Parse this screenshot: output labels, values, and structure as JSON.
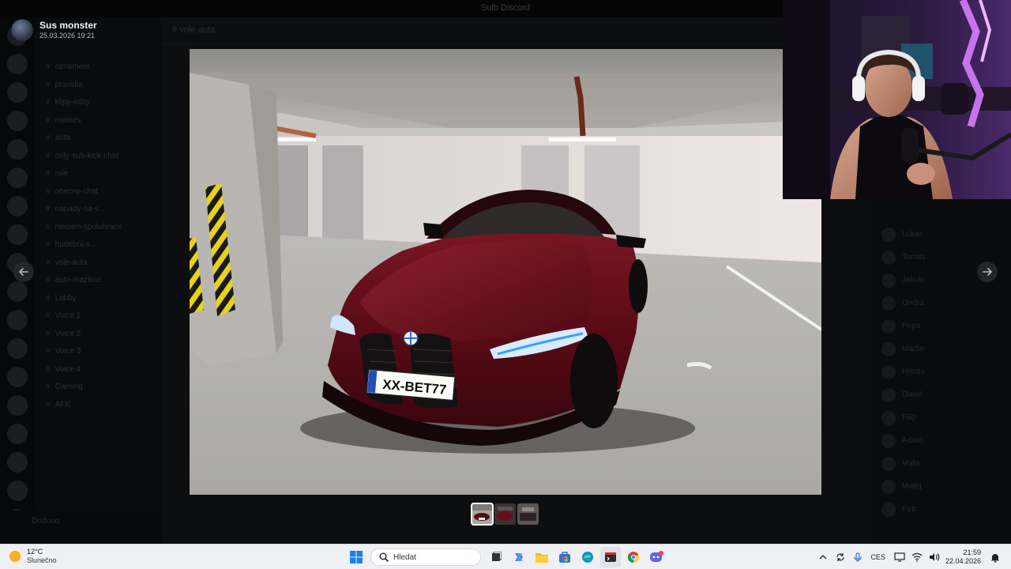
{
  "background": {
    "window_title": "Sulb Discord",
    "channel_header": "# vole-auta",
    "channels": [
      {
        "label": "oznameni"
      },
      {
        "label": "pravidla"
      },
      {
        "label": "klipy-edity"
      },
      {
        "label": "memes"
      },
      {
        "label": "auta"
      },
      {
        "label": "only-sub-kick-chat"
      },
      {
        "label": "role"
      },
      {
        "label": "obecny-chat"
      },
      {
        "label": "napady-na-v..."
      },
      {
        "label": "hledam-spoluhrace"
      },
      {
        "label": "hudebni-s..."
      },
      {
        "label": "vole-auta"
      },
      {
        "label": "auto-mazlicci"
      },
      {
        "label": "Lobby"
      },
      {
        "label": "Voice 1"
      },
      {
        "label": "Voice 2"
      },
      {
        "label": "Voice 3"
      },
      {
        "label": "Voice 4"
      },
      {
        "label": "Gaming"
      },
      {
        "label": "AFK"
      }
    ],
    "members": [
      {
        "name": "Lukas"
      },
      {
        "name": "Tomas"
      },
      {
        "name": "Jakub"
      },
      {
        "name": "Ondra"
      },
      {
        "name": "Pepa"
      },
      {
        "name": "Martin"
      },
      {
        "name": "Honza"
      },
      {
        "name": "David"
      },
      {
        "name": "Filip"
      },
      {
        "name": "Adam"
      },
      {
        "name": "Vojta"
      },
      {
        "name": "Matej"
      },
      {
        "name": "Petr"
      }
    ],
    "user_panel": "Dodouo"
  },
  "viewer": {
    "author": "Sus monster",
    "timestamp": "25.03.2026 19:21",
    "plate_text": "XX-BET77",
    "plate_country": "SK",
    "thumbnails_count": 3,
    "selected_thumbnail": 1
  },
  "taskbar": {
    "weather_temp": "12°C",
    "weather_desc": "Slunečno",
    "search_placeholder": "Hledat",
    "language": "CES",
    "time": "21:59",
    "date": "22.04.2026"
  },
  "colors": {
    "car_red": "#6a0f1a",
    "taskbar_bg": "#eef0f4",
    "cam_light": "#c061ff"
  }
}
